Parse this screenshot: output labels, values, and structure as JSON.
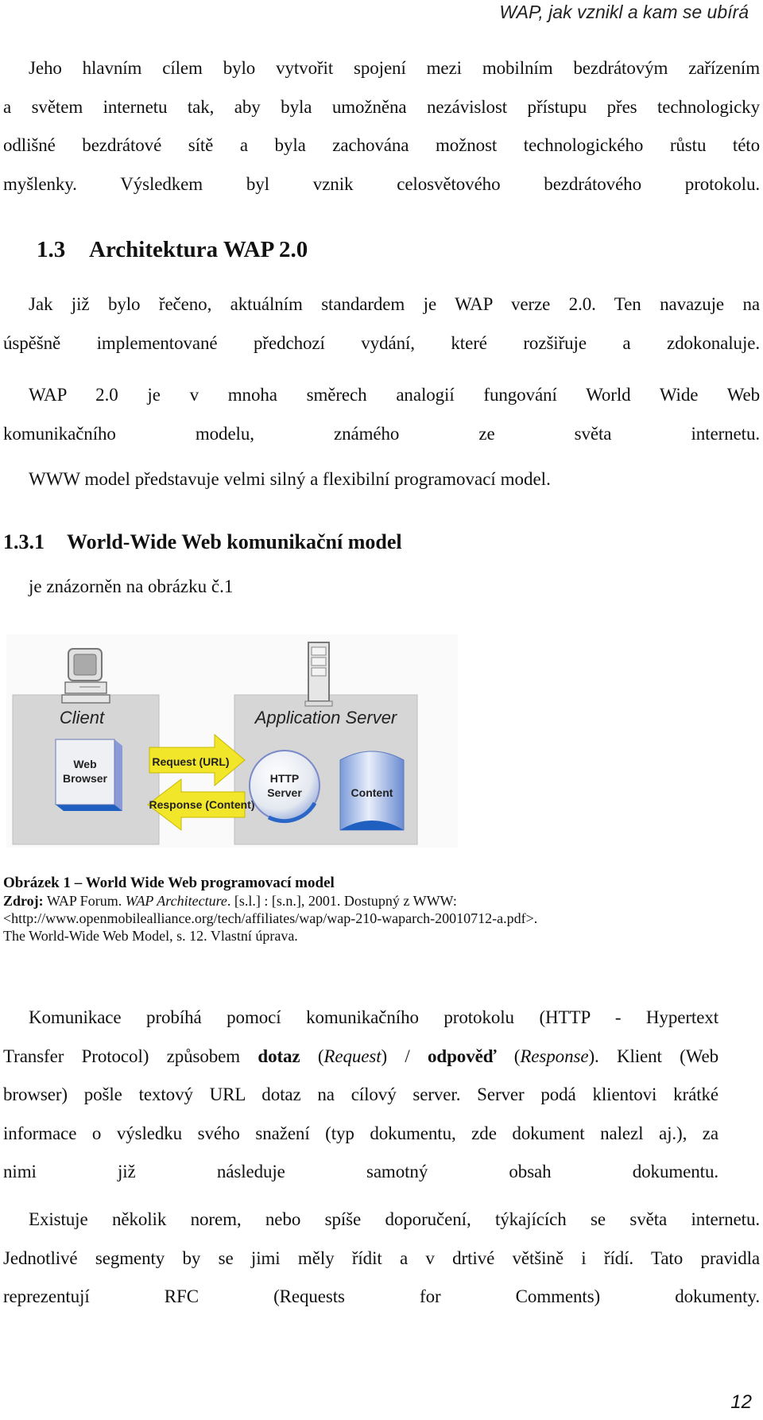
{
  "header": {
    "running_title": "WAP, jak vznikl a kam se ubírá"
  },
  "intro_paragraph": {
    "lines": [
      "Jeho hlavním cílem bylo vytvořit spojení mezi mobilním bezdrátovým zařízením",
      "a světem internetu tak, aby byla umožněna nezávislost přístupu přes  technologicky",
      "odlišné bezdrátové sítě a byla zachována možnost technologického růstu této",
      "myšlenky. Výsledkem byl vznik celosvětového bezdrátového protokolu."
    ]
  },
  "section_1_3": {
    "number": "1.3",
    "title": "Architektura WAP 2.0",
    "paragraph1": [
      "Jak již bylo řečeno, aktuálním standardem je WAP verze 2.0. Ten navazuje na",
      "úspěšně implementované předchozí vydání, které rozšiřuje a zdokonaluje."
    ],
    "paragraph2": [
      "WAP 2.0 je v mnoha směrech analogií fungování World Wide Web",
      "komunikačního modelu, známého ze světa internetu."
    ],
    "paragraph3": "WWW model představuje velmi silný a flexibilní programovací model."
  },
  "section_1_3_1": {
    "number": "1.3.1",
    "title": "World-Wide Web komunikační model",
    "intro": "je znázorněn na obrázku č.1"
  },
  "figure": {
    "client_label": "Client",
    "browser_label_line1": "Web",
    "browser_label_line2": "Browser",
    "server_label": "Application Server",
    "http_label_line1": "HTTP",
    "http_label_line2": "Server",
    "content_label": "Content",
    "request_arrow": "Request (URL)",
    "response_arrow": "Response (Content)",
    "colors": {
      "panel": "#d6d6d6",
      "arrow": "#f2e62a",
      "blue": "#2a66c8",
      "box": "#e8ecf4"
    }
  },
  "caption": {
    "title": "Obrázek 1 – World Wide Web programovací model",
    "source_label": "Zdroj:",
    "source_text1": " WAP Forum. ",
    "source_italic": "WAP Architecture",
    "source_text2": ". [s.l.] : [s.n.], 2001. Dostupný z WWW:",
    "url": "<http://www.openmobilealliance.org/tech/affiliates/wap/wap-210-waparch-20010712-a.pdf>.",
    "note": "The World-Wide Web Model, s. 12. Vlastní úprava."
  },
  "communication_paragraph": {
    "l1": "Komunikace probíhá pomocí komunikačního protokolu (HTTP - Hypertext",
    "l2_a": "Transfer Protocol) způsobem ",
    "l2_bold1": "dotaz",
    "l2_b": " (",
    "l2_it1": "Request",
    "l2_c": ") / ",
    "l2_bold2": "odpověď",
    "l2_d": " (",
    "l2_it2": "Response",
    "l2_e": "). Klient (Web",
    "l3": "browser) pošle textový URL dotaz na cílový server. Server podá klientovi krátké",
    "l4": "informace o výsledku svého snažení (typ dokumentu, zde dokument nalezl aj.), za",
    "l5": "nimi již následuje samotný obsah dokumentu."
  },
  "rfc_paragraph": {
    "lines": [
      "Existuje několik norem, nebo spíše doporučení, týkajících se světa internetu.",
      "Jednotlivé segmenty by se jimi měly řídit a v drtivé většině i řídí. Tato pravidla",
      "reprezentují RFC (Requests for Comments) dokumenty."
    ]
  },
  "footer": {
    "page_number": "12"
  }
}
